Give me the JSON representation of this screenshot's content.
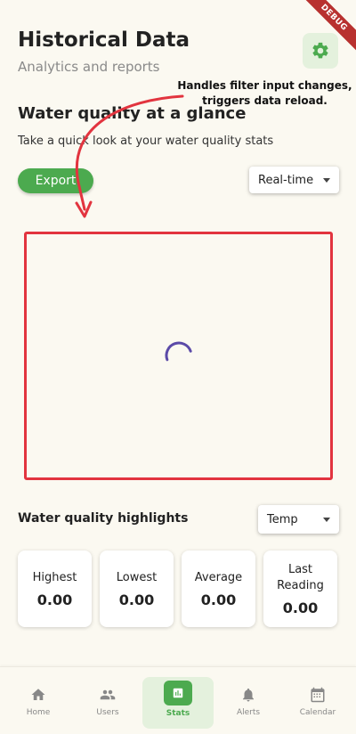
{
  "debug_banner": "DEBUG",
  "header": {
    "title": "Historical Data",
    "subtitle": "Analytics and reports",
    "settings_icon": "gear-icon"
  },
  "overview": {
    "title": "Water quality at a glance",
    "description": "Take a quick look at your water quality stats",
    "export_label": "Export",
    "range_selected": "Real-time"
  },
  "annotation": {
    "line1": "Handles filter input changes,",
    "line2": "triggers data reload."
  },
  "highlights": {
    "title": "Water quality highlights",
    "metric_selected": "Temp",
    "cards": [
      {
        "label": "Highest",
        "value": "0.00"
      },
      {
        "label": "Lowest",
        "value": "0.00"
      },
      {
        "label": "Average",
        "value": "0.00"
      },
      {
        "label_line1": "Last",
        "label_line2": "Reading",
        "value": "0.00"
      }
    ]
  },
  "colors": {
    "accent": "#4caa4f",
    "accent_light": "#e4f1dd",
    "highlight_box": "#e2343f",
    "spinner": "#5b4aa8",
    "background": "#fbf9f1"
  },
  "nav": {
    "items": [
      {
        "label": "Home",
        "icon": "home-icon"
      },
      {
        "label": "Users",
        "icon": "users-icon"
      },
      {
        "label": "Stats",
        "icon": "stats-icon",
        "active": true
      },
      {
        "label": "Alerts",
        "icon": "bell-icon"
      },
      {
        "label": "Calendar",
        "icon": "calendar-icon"
      }
    ]
  }
}
